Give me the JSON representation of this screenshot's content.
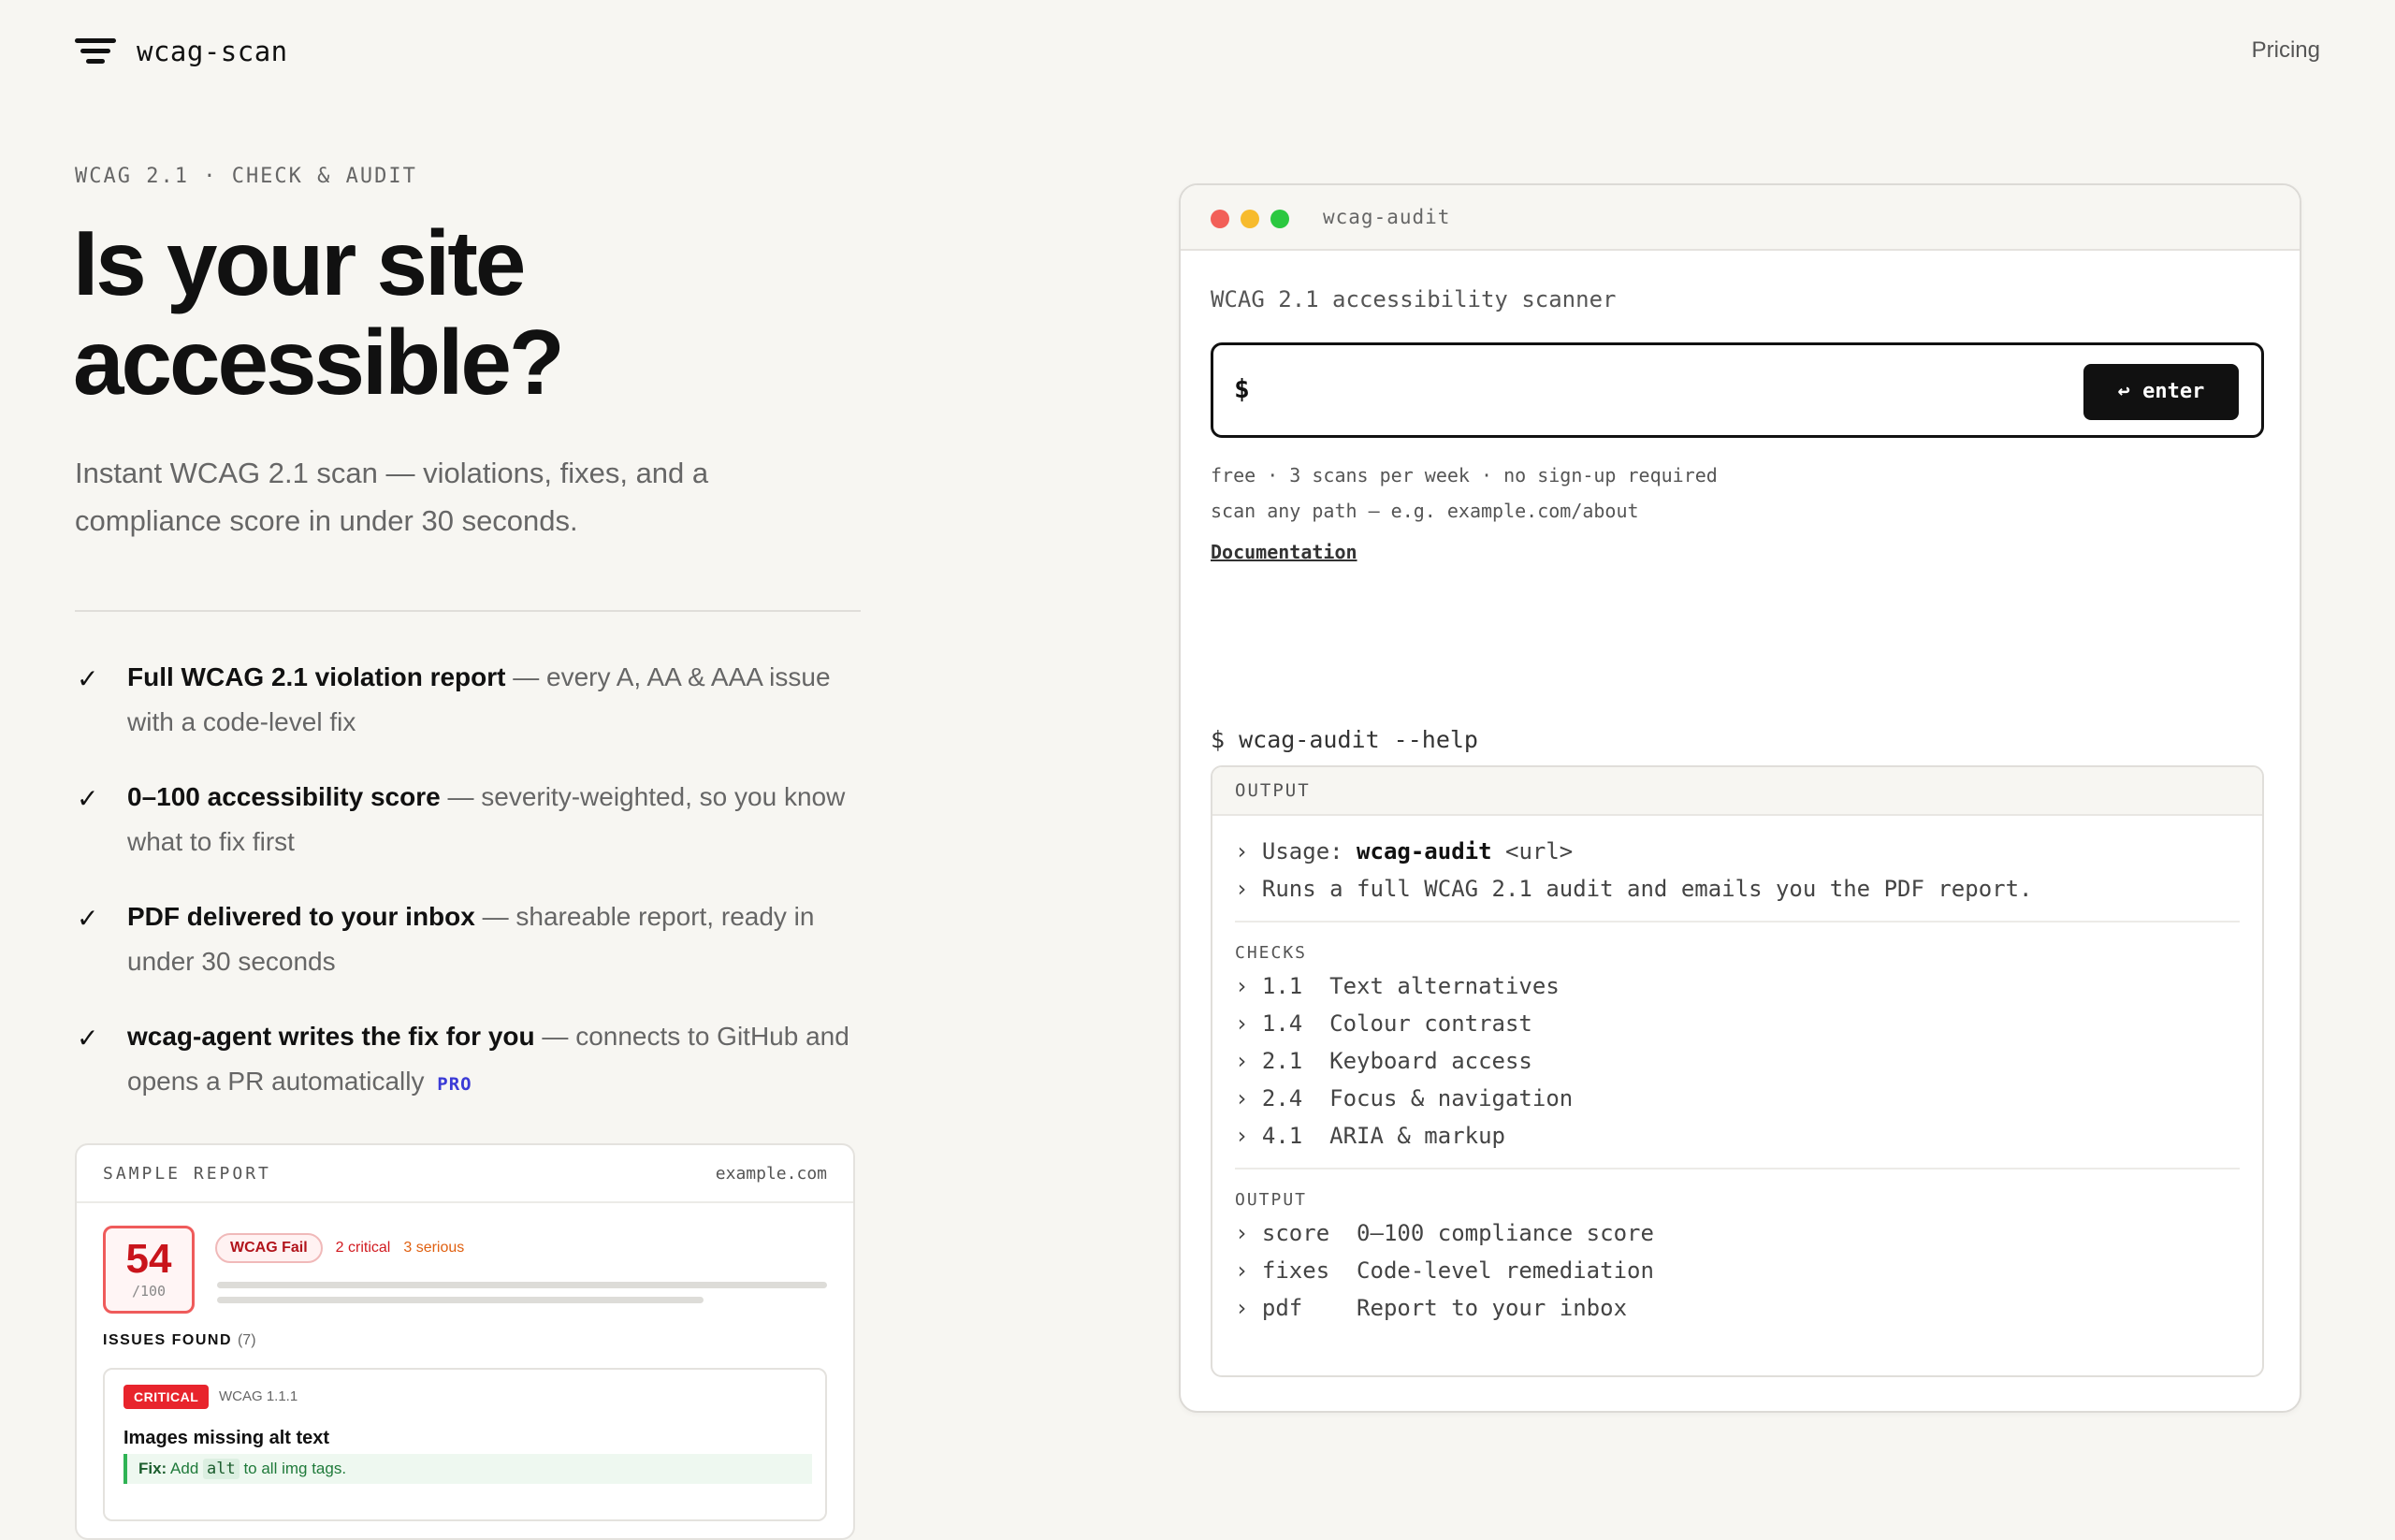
{
  "header": {
    "brand": "wcag-scan",
    "nav_pricing": "Pricing"
  },
  "hero": {
    "eyebrow": "WCAG 2.1 · CHECK & AUDIT",
    "title": "Is your site accessible?",
    "subtitle": "Instant WCAG 2.1 scan — violations, fixes, and a compliance score in under 30 seconds."
  },
  "features": [
    {
      "title": "Full WCAG 2.1 violation report",
      "desc": " — every A, AA & AAA issue with a code-level fix"
    },
    {
      "title": "0–100 accessibility score",
      "desc": " — severity-weighted, so you know what to fix first"
    },
    {
      "title": "PDF delivered to your inbox",
      "desc": " — shareable report, ready in under 30 seconds"
    },
    {
      "title": "wcag-agent writes the fix for you",
      "desc": " — connects to GitHub and opens a PR automatically",
      "badge": "PRO"
    }
  ],
  "sample_report": {
    "label": "SAMPLE REPORT",
    "domain": "example.com",
    "score": "54",
    "score_denominator": "/100",
    "status": "WCAG Fail",
    "critical": "2 critical",
    "serious": "3 serious",
    "issues_label": "ISSUES FOUND",
    "issues_count": "(7)",
    "issue": {
      "severity": "CRITICAL",
      "criterion": "WCAG 1.1.1",
      "title": "Images missing alt text",
      "fix_label": "Fix:",
      "fix_pre": " Add ",
      "fix_code": "alt",
      "fix_post": " to all img tags."
    }
  },
  "terminal": {
    "title": "wcag-audit",
    "scanner_label": "WCAG 2.1 accessibility scanner",
    "prompt": "$",
    "input_value": "",
    "input_placeholder": "",
    "enter_label": "↩ enter",
    "meta_line1": "free · 3 scans per week · no sign-up required",
    "meta_line2": "scan any path — e.g. example.com/about",
    "doc_link": "Documentation",
    "command": "$ wcag-audit --help",
    "output_header": "OUTPUT",
    "usage_pre": "› Usage: ",
    "usage_cmd": "wcag-audit",
    "usage_arg": " <url>",
    "usage_desc": "› Runs a full WCAG 2.1 audit and emails you the PDF report.",
    "checks_label": "CHECKS",
    "checks": [
      "› 1.1  Text alternatives",
      "› 1.4  Colour contrast",
      "› 2.1  Keyboard access",
      "› 2.4  Focus & navigation",
      "› 4.1  ARIA & markup"
    ],
    "output_label": "OUTPUT",
    "outputs": [
      "› score  0–100 compliance score",
      "› fixes  Code-level remediation",
      "› pdf    Report to your inbox"
    ]
  }
}
